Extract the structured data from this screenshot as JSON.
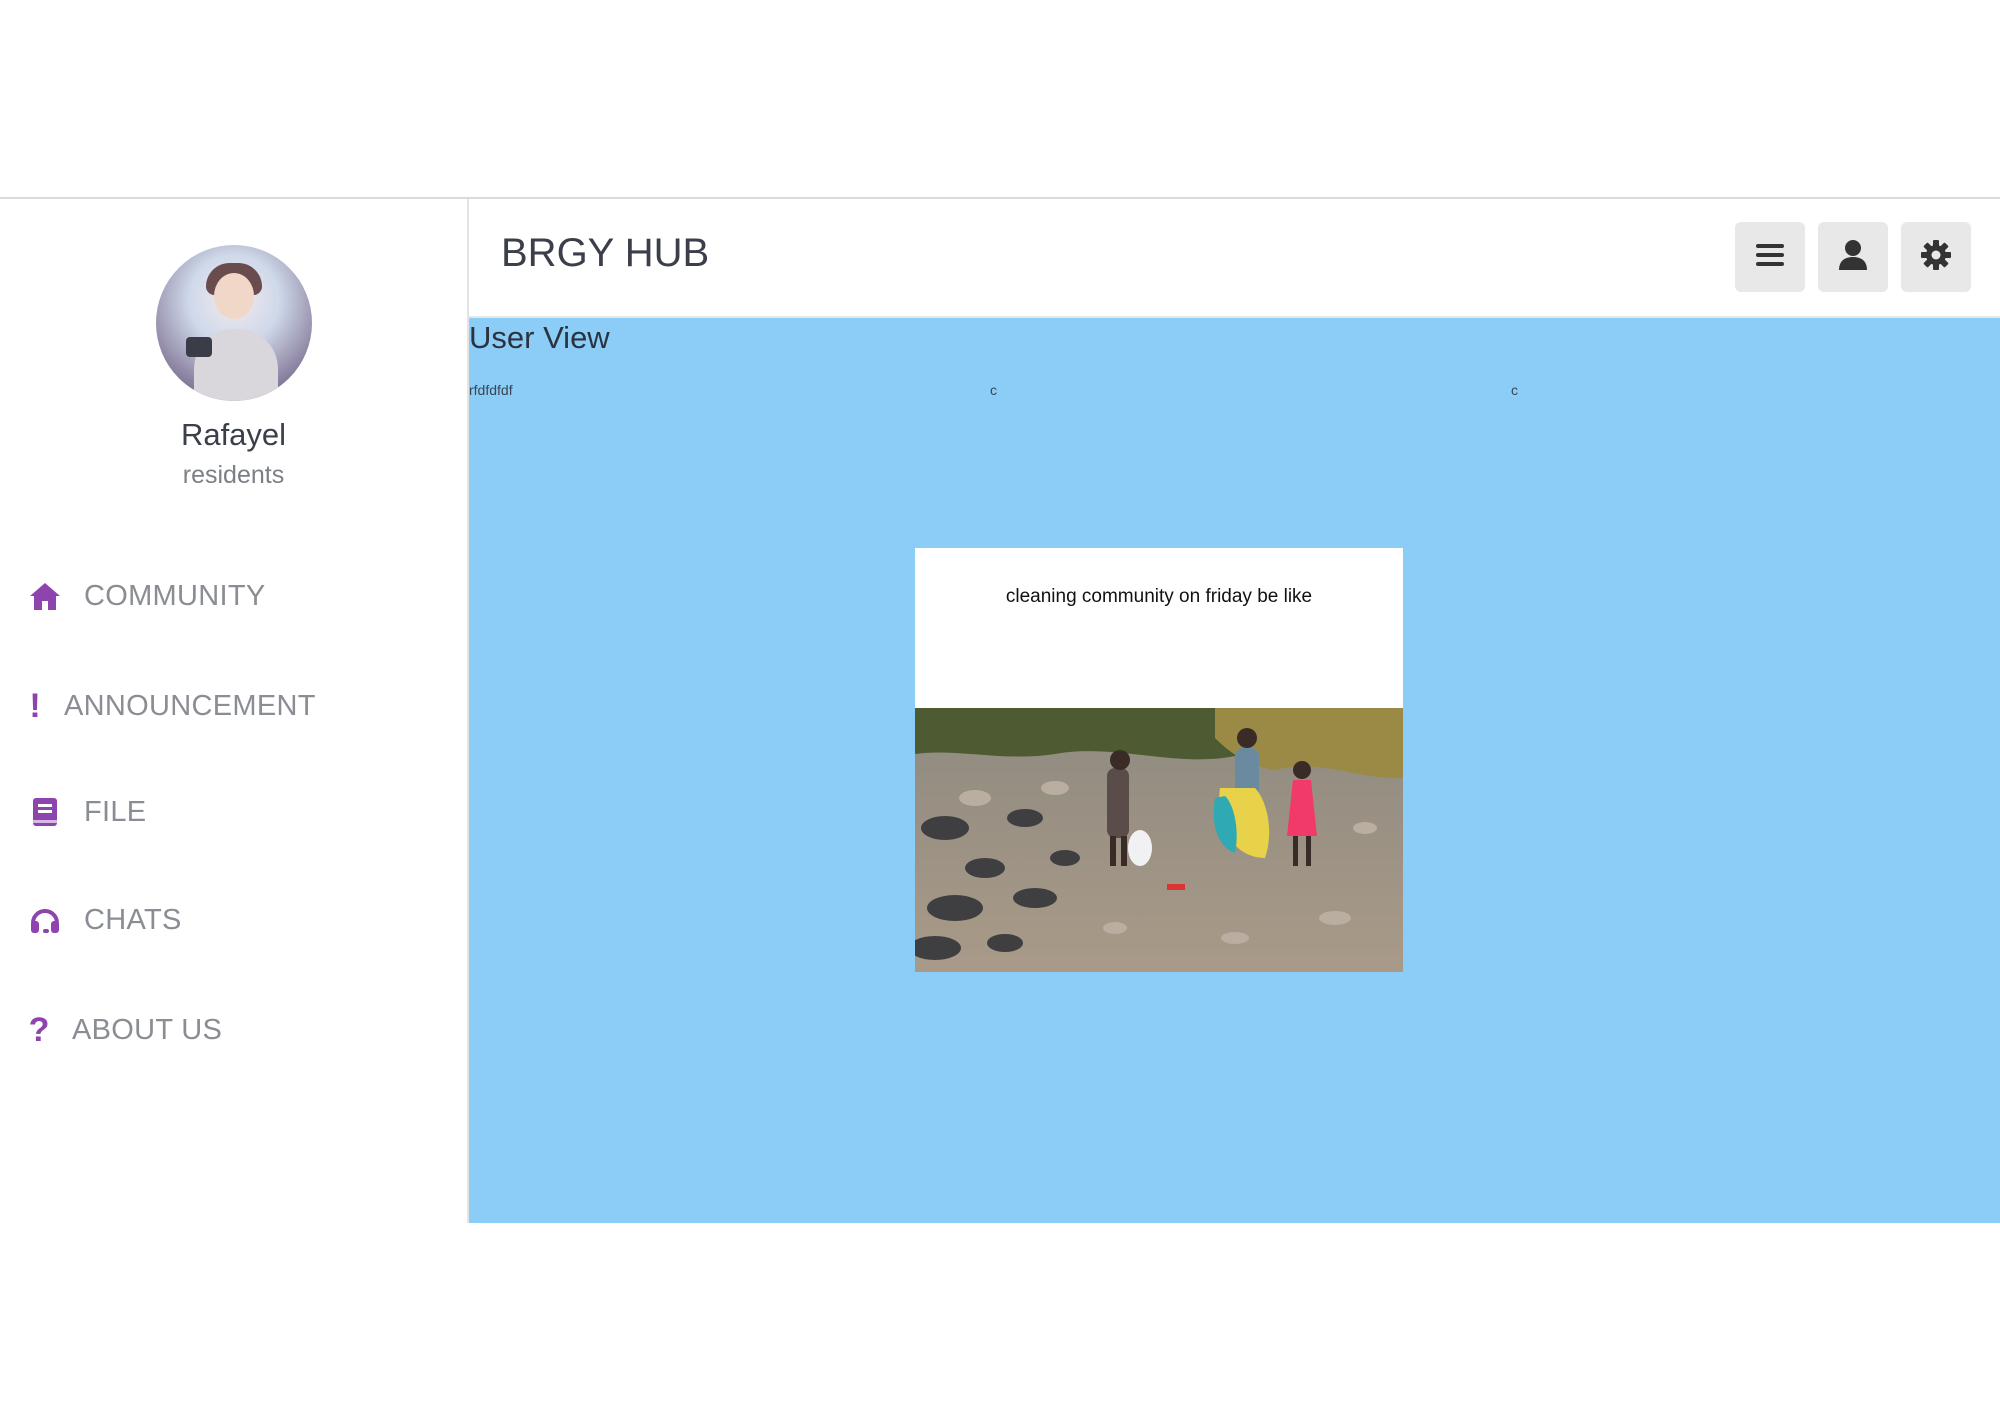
{
  "header": {
    "app_title": "BRGY HUB",
    "buttons": [
      {
        "icon": "menu-icon"
      },
      {
        "icon": "user-icon"
      },
      {
        "icon": "gear-icon"
      }
    ]
  },
  "profile": {
    "name": "Rafayel",
    "role": "residents"
  },
  "sidebar": {
    "items": [
      {
        "label": "COMMUNITY",
        "icon": "home-icon"
      },
      {
        "label": "ANNOUNCEMENT",
        "icon": "exclamation-icon"
      },
      {
        "label": "FILE",
        "icon": "book-icon"
      },
      {
        "label": "CHATS",
        "icon": "headset-icon"
      },
      {
        "label": "ABOUT US",
        "icon": "question-icon"
      }
    ]
  },
  "main": {
    "view_title": "User View",
    "row_texts": [
      "rfdfdfdf",
      "c",
      "c"
    ],
    "post": {
      "caption": "cleaning community on friday be like"
    }
  },
  "colors": {
    "accent": "#8e44ad",
    "main_bg": "#8ccdf8"
  }
}
